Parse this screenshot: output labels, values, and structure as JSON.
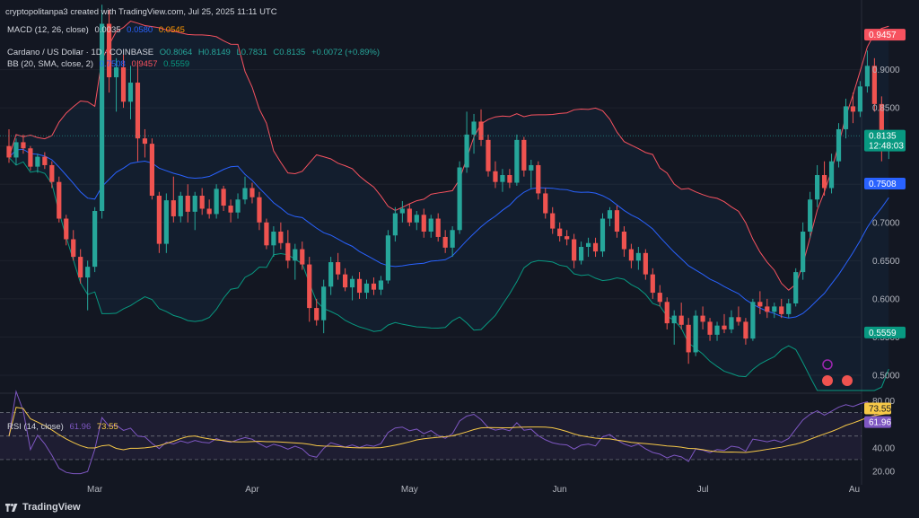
{
  "header": {
    "created_by": "cryptopolitanpa3 created with TradingView.com, Jul 25, 2025 11:11 UTC"
  },
  "legend": {
    "macd_label": "MACD (12, 26, close)",
    "macd_v1": "0.0035",
    "macd_v2": "0.0580",
    "macd_v3": "0.0545",
    "symbol_label": "Cardano / US Dollar · 1D · COINBASE",
    "ohlc": {
      "o": "O0.8064",
      "h": "H0.8149",
      "l": "L0.7831",
      "c": "C0.8135",
      "chg": "+0.0072 (+0.89%)"
    },
    "bb_label": "BB (20, SMA, close, 2)",
    "bb_mid": "0.7508",
    "bb_up": "0.9457",
    "bb_low": "0.5559",
    "rsi_label": "RSI (14, close)",
    "rsi_v": "61.96",
    "rsi_ma": "73.55"
  },
  "price_axis_labels": [
    "0.9000",
    "0.8500",
    "0.8000",
    "0.7500",
    "0.7000",
    "0.6500",
    "0.6000",
    "0.5500",
    "0.5000"
  ],
  "price_badges": {
    "upper": "0.9457",
    "last": "0.8135",
    "countdown": "12:48:03",
    "mid": "0.7508",
    "lower": "0.5559"
  },
  "rsi_axis_labels": [
    "80.00",
    "40.00",
    "20.00"
  ],
  "rsi_badges": {
    "ma": "73.55",
    "rsi": "61.96"
  },
  "time_labels": [
    "Mar",
    "Apr",
    "May",
    "Jun",
    "Jul",
    "Au"
  ],
  "footer": {
    "brand": "TradingView"
  },
  "colors": {
    "up": "#26a69a",
    "down": "#ef5350",
    "bb_basis": "#2962ff",
    "bb_upper": "#f7525f",
    "bb_lower": "#089981",
    "rsi": "#7e57c2",
    "rsi_ma": "#f7c948",
    "bg": "#131722"
  },
  "chart_data": {
    "type": "candlestick",
    "symbol": "Cardano / US Dollar",
    "interval": "1D",
    "exchange": "COINBASE",
    "ylim": [
      0.48,
      0.97
    ],
    "candles": [
      [
        0.8,
        0.822,
        0.778,
        0.785
      ],
      [
        0.785,
        0.81,
        0.775,
        0.805
      ],
      [
        0.805,
        0.815,
        0.79,
        0.797
      ],
      [
        0.797,
        0.8,
        0.768,
        0.773
      ],
      [
        0.773,
        0.79,
        0.765,
        0.786
      ],
      [
        0.786,
        0.792,
        0.77,
        0.775
      ],
      [
        0.775,
        0.78,
        0.745,
        0.753
      ],
      [
        0.753,
        0.76,
        0.7,
        0.705
      ],
      [
        0.705,
        0.71,
        0.67,
        0.678
      ],
      [
        0.678,
        0.69,
        0.65,
        0.655
      ],
      [
        0.655,
        0.665,
        0.62,
        0.628
      ],
      [
        0.628,
        0.65,
        0.585,
        0.642
      ],
      [
        0.642,
        0.72,
        0.635,
        0.715
      ],
      [
        0.715,
        0.985,
        0.705,
        0.96
      ],
      [
        0.96,
        0.978,
        0.87,
        0.89
      ],
      [
        0.89,
        0.915,
        0.845,
        0.903
      ],
      [
        0.903,
        0.92,
        0.85,
        0.858
      ],
      [
        0.858,
        0.905,
        0.835,
        0.883
      ],
      [
        0.883,
        0.912,
        0.78,
        0.81
      ],
      [
        0.81,
        0.822,
        0.785,
        0.803
      ],
      [
        0.803,
        0.81,
        0.73,
        0.735
      ],
      [
        0.735,
        0.74,
        0.66,
        0.672
      ],
      [
        0.672,
        0.738,
        0.66,
        0.729
      ],
      [
        0.729,
        0.76,
        0.7,
        0.708
      ],
      [
        0.708,
        0.74,
        0.7,
        0.735
      ],
      [
        0.735,
        0.75,
        0.7,
        0.714
      ],
      [
        0.714,
        0.74,
        0.69,
        0.735
      ],
      [
        0.735,
        0.745,
        0.71,
        0.718
      ],
      [
        0.718,
        0.73,
        0.705,
        0.711
      ],
      [
        0.711,
        0.75,
        0.705,
        0.744
      ],
      [
        0.744,
        0.748,
        0.715,
        0.722
      ],
      [
        0.722,
        0.73,
        0.7,
        0.713
      ],
      [
        0.713,
        0.738,
        0.705,
        0.73
      ],
      [
        0.73,
        0.76,
        0.724,
        0.745
      ],
      [
        0.745,
        0.752,
        0.725,
        0.733
      ],
      [
        0.733,
        0.74,
        0.69,
        0.7
      ],
      [
        0.7,
        0.705,
        0.665,
        0.67
      ],
      [
        0.67,
        0.695,
        0.655,
        0.688
      ],
      [
        0.688,
        0.7,
        0.665,
        0.673
      ],
      [
        0.673,
        0.69,
        0.64,
        0.65
      ],
      [
        0.65,
        0.672,
        0.625,
        0.665
      ],
      [
        0.665,
        0.675,
        0.638,
        0.645
      ],
      [
        0.645,
        0.655,
        0.57,
        0.588
      ],
      [
        0.588,
        0.6,
        0.565,
        0.572
      ],
      [
        0.572,
        0.625,
        0.555,
        0.616
      ],
      [
        0.616,
        0.655,
        0.605,
        0.648
      ],
      [
        0.648,
        0.66,
        0.625,
        0.632
      ],
      [
        0.632,
        0.64,
        0.61,
        0.615
      ],
      [
        0.615,
        0.63,
        0.598,
        0.626
      ],
      [
        0.626,
        0.635,
        0.6,
        0.608
      ],
      [
        0.608,
        0.625,
        0.6,
        0.62
      ],
      [
        0.62,
        0.628,
        0.605,
        0.612
      ],
      [
        0.612,
        0.63,
        0.605,
        0.624
      ],
      [
        0.624,
        0.69,
        0.62,
        0.683
      ],
      [
        0.683,
        0.72,
        0.675,
        0.712
      ],
      [
        0.712,
        0.728,
        0.7,
        0.718
      ],
      [
        0.718,
        0.725,
        0.695,
        0.7
      ],
      [
        0.7,
        0.715,
        0.69,
        0.71
      ],
      [
        0.71,
        0.718,
        0.68,
        0.688
      ],
      [
        0.688,
        0.71,
        0.68,
        0.705
      ],
      [
        0.705,
        0.712,
        0.675,
        0.681
      ],
      [
        0.681,
        0.69,
        0.66,
        0.667
      ],
      [
        0.667,
        0.695,
        0.655,
        0.69
      ],
      [
        0.69,
        0.78,
        0.685,
        0.772
      ],
      [
        0.772,
        0.845,
        0.765,
        0.815
      ],
      [
        0.815,
        0.842,
        0.79,
        0.832
      ],
      [
        0.832,
        0.848,
        0.8,
        0.808
      ],
      [
        0.808,
        0.815,
        0.76,
        0.767
      ],
      [
        0.767,
        0.78,
        0.745,
        0.753
      ],
      [
        0.753,
        0.77,
        0.74,
        0.762
      ],
      [
        0.762,
        0.77,
        0.745,
        0.752
      ],
      [
        0.752,
        0.815,
        0.748,
        0.808
      ],
      [
        0.808,
        0.812,
        0.76,
        0.768
      ],
      [
        0.768,
        0.782,
        0.745,
        0.775
      ],
      [
        0.775,
        0.78,
        0.73,
        0.738
      ],
      [
        0.738,
        0.745,
        0.705,
        0.712
      ],
      [
        0.712,
        0.72,
        0.685,
        0.692
      ],
      [
        0.692,
        0.7,
        0.675,
        0.682
      ],
      [
        0.682,
        0.69,
        0.67,
        0.678
      ],
      [
        0.678,
        0.685,
        0.64,
        0.65
      ],
      [
        0.65,
        0.675,
        0.645,
        0.668
      ],
      [
        0.668,
        0.68,
        0.655,
        0.673
      ],
      [
        0.673,
        0.68,
        0.655,
        0.662
      ],
      [
        0.662,
        0.712,
        0.655,
        0.705
      ],
      [
        0.705,
        0.72,
        0.695,
        0.716
      ],
      [
        0.716,
        0.722,
        0.68,
        0.688
      ],
      [
        0.688,
        0.695,
        0.655,
        0.665
      ],
      [
        0.665,
        0.672,
        0.64,
        0.65
      ],
      [
        0.65,
        0.668,
        0.638,
        0.66
      ],
      [
        0.66,
        0.665,
        0.625,
        0.632
      ],
      [
        0.632,
        0.64,
        0.6,
        0.608
      ],
      [
        0.608,
        0.618,
        0.59,
        0.596
      ],
      [
        0.596,
        0.602,
        0.56,
        0.568
      ],
      [
        0.568,
        0.585,
        0.54,
        0.578
      ],
      [
        0.578,
        0.595,
        0.56,
        0.566
      ],
      [
        0.566,
        0.575,
        0.515,
        0.53
      ],
      [
        0.53,
        0.585,
        0.525,
        0.578
      ],
      [
        0.578,
        0.59,
        0.56,
        0.57
      ],
      [
        0.57,
        0.575,
        0.545,
        0.553
      ],
      [
        0.553,
        0.57,
        0.545,
        0.565
      ],
      [
        0.565,
        0.58,
        0.555,
        0.56
      ],
      [
        0.56,
        0.585,
        0.555,
        0.576
      ],
      [
        0.576,
        0.59,
        0.565,
        0.57
      ],
      [
        0.57,
        0.575,
        0.54,
        0.548
      ],
      [
        0.548,
        0.6,
        0.545,
        0.596
      ],
      [
        0.596,
        0.61,
        0.58,
        0.59
      ],
      [
        0.59,
        0.6,
        0.575,
        0.583
      ],
      [
        0.583,
        0.595,
        0.575,
        0.59
      ],
      [
        0.59,
        0.6,
        0.575,
        0.58
      ],
      [
        0.58,
        0.6,
        0.575,
        0.594
      ],
      [
        0.594,
        0.64,
        0.59,
        0.635
      ],
      [
        0.635,
        0.7,
        0.625,
        0.688
      ],
      [
        0.688,
        0.74,
        0.68,
        0.73
      ],
      [
        0.73,
        0.775,
        0.72,
        0.762
      ],
      [
        0.762,
        0.78,
        0.735,
        0.745
      ],
      [
        0.745,
        0.79,
        0.738,
        0.78
      ],
      [
        0.78,
        0.83,
        0.772,
        0.822
      ],
      [
        0.822,
        0.862,
        0.81,
        0.852
      ],
      [
        0.852,
        0.87,
        0.83,
        0.845
      ],
      [
        0.845,
        0.885,
        0.838,
        0.878
      ],
      [
        0.878,
        0.925,
        0.87,
        0.905
      ],
      [
        0.905,
        0.915,
        0.845,
        0.855
      ],
      [
        0.855,
        0.865,
        0.78,
        0.806
      ],
      [
        0.806,
        0.815,
        0.783,
        0.8135
      ]
    ]
  }
}
